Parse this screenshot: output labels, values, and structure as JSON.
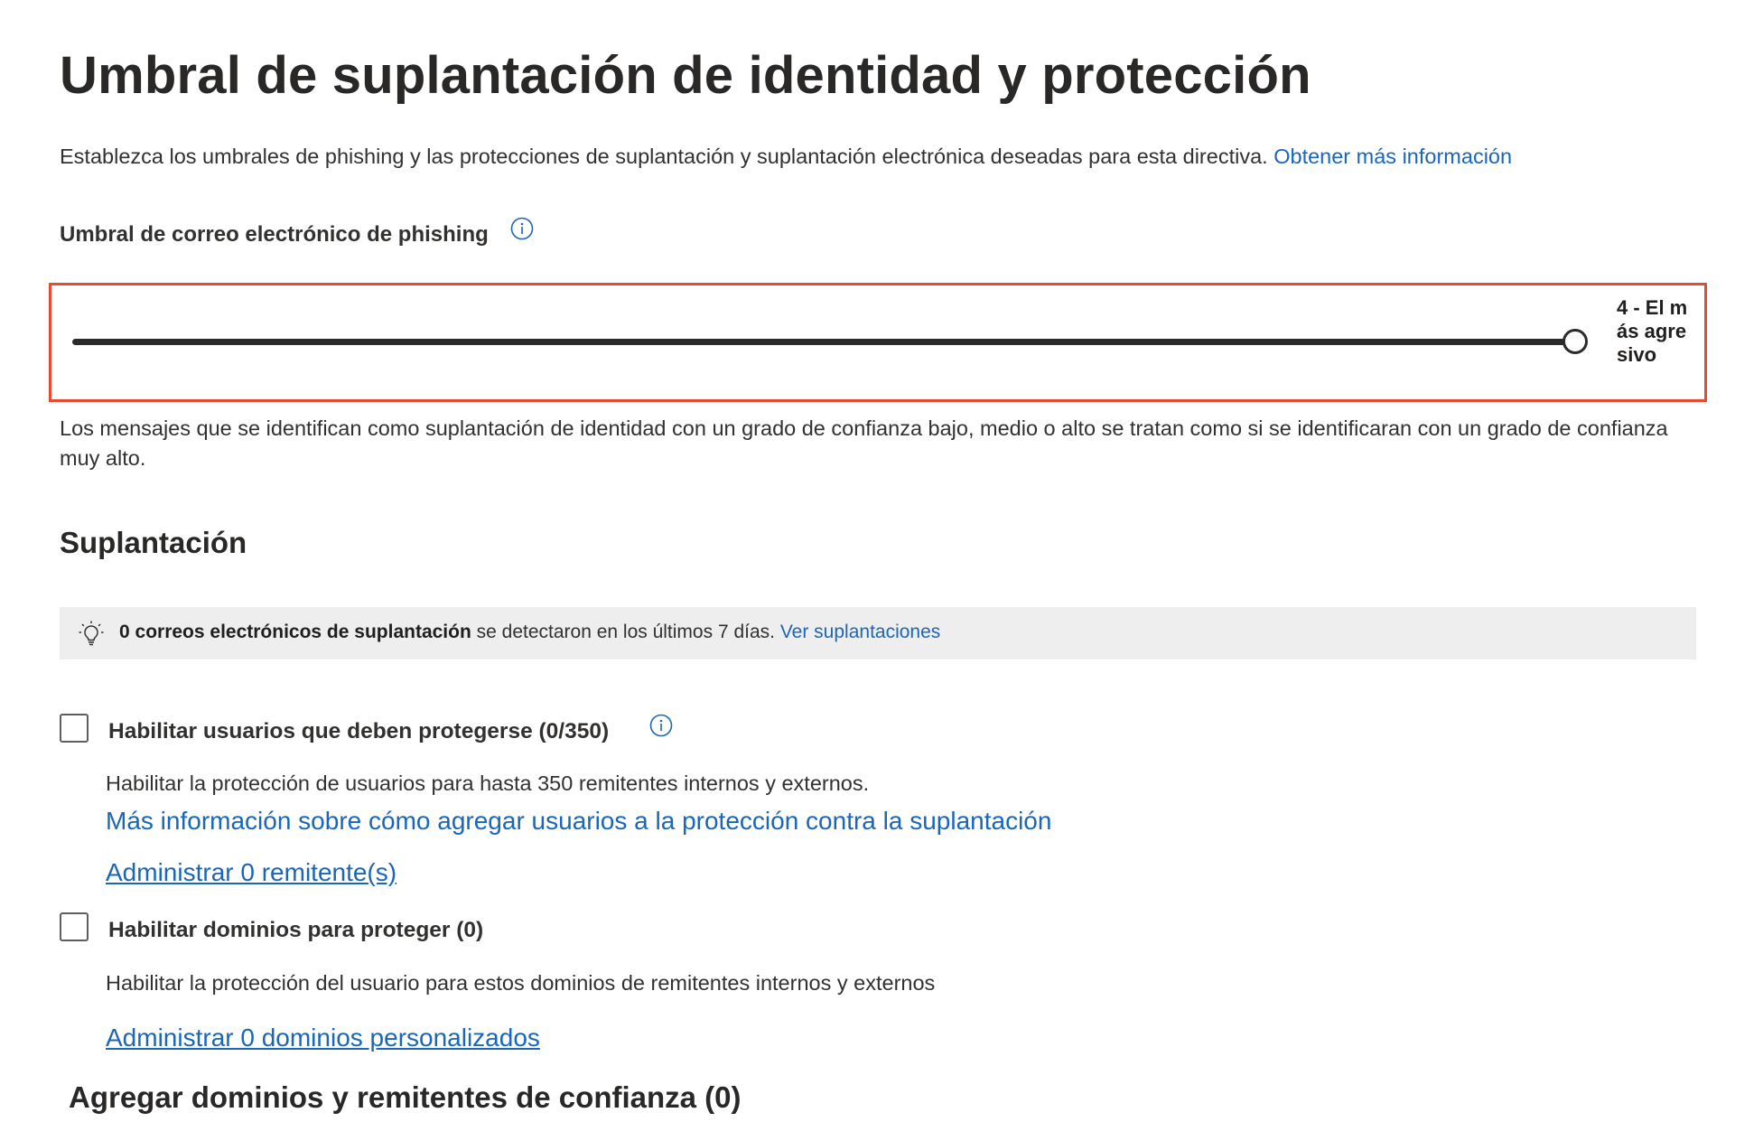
{
  "page": {
    "title": "Umbral de suplantación de identidad y protección"
  },
  "intro": {
    "text": "Establezca los umbrales de phishing y las protecciones de suplantación y suplantación electrónica deseadas para esta directiva.",
    "learn_more_link": "Obtener más información"
  },
  "phishing_threshold": {
    "label": "Umbral de correo electrónico de phishing",
    "info_icon": "info-icon",
    "slider_value_label": "4 - El más agresivo",
    "slider_level": 4,
    "slider_max": 4,
    "description": "Los mensajes que se identifican como suplantación de identidad con un grado de confianza bajo, medio o alto se tratan como si se identificaran con un grado de confianza muy alto."
  },
  "impersonation": {
    "heading": "Suplantación",
    "banner": {
      "icon": "lightbulb-icon",
      "bold_text": "0 correos electrónicos de suplantación",
      "text": " se detectaron en los últimos 7 días. ",
      "link": "Ver suplantaciones"
    },
    "protect_users": {
      "label": "Habilitar usuarios que deben protegerse (0/350)",
      "checked": false,
      "info_icon": "info-icon",
      "description": "Habilitar la protección de usuarios para hasta 350 remitentes internos y externos.",
      "more_info_link": "Más información sobre cómo agregar usuarios a la protección contra la suplantación",
      "manage_link": "Administrar 0 remitente(s)"
    },
    "protect_domains": {
      "label": "Habilitar dominios para proteger (0)",
      "checked": false,
      "description": "Habilitar la protección del usuario para estos dominios de remitentes internos y externos",
      "manage_link": "Administrar 0 dominios personalizados"
    }
  },
  "trusted": {
    "heading": "Agregar dominios y remitentes de confianza (0)"
  },
  "colors": {
    "link": "#1a66b8",
    "highlight_border": "#e64a33",
    "slider": "#2b2b2b",
    "banner_bg": "#eeeeee"
  }
}
